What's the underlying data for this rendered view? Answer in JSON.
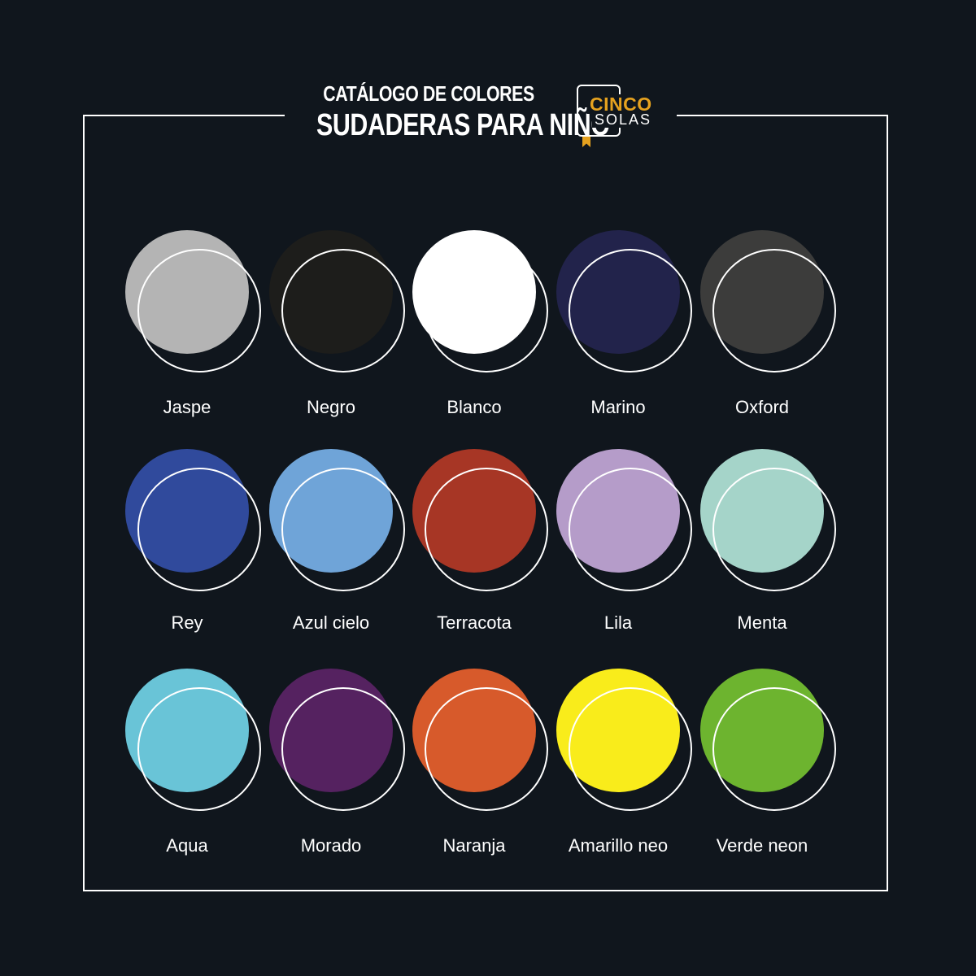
{
  "header": {
    "title_small": "CATÁLOGO DE COLORES",
    "title_large": "SUDADERAS PARA NIÑO"
  },
  "logo": {
    "line1": "CINCO",
    "line2": "SOLAS",
    "accent_color": "#e6a21f"
  },
  "colors": {
    "background": "#10161d",
    "outline": "#ffffff"
  },
  "swatches": [
    {
      "name": "Jaspe",
      "color": "#b4b4b4"
    },
    {
      "name": "Negro",
      "color": "#1d1d1b"
    },
    {
      "name": "Blanco",
      "color": "#ffffff"
    },
    {
      "name": "Marino",
      "color": "#22234b"
    },
    {
      "name": "Oxford",
      "color": "#3c3c3b"
    },
    {
      "name": "Rey",
      "color": "#304a9c"
    },
    {
      "name": "Azul cielo",
      "color": "#6fa4d8"
    },
    {
      "name": "Terracota",
      "color": "#a73625"
    },
    {
      "name": "Lila",
      "color": "#b59cc9"
    },
    {
      "name": "Menta",
      "color": "#a5d4c9"
    },
    {
      "name": "Aqua",
      "color": "#69c4d7"
    },
    {
      "name": "Morado",
      "color": "#552260"
    },
    {
      "name": "Naranja",
      "color": "#d75a2b"
    },
    {
      "name": "Amarillo neo",
      "color": "#f9ec1b"
    },
    {
      "name": "Verde neon",
      "color": "#6db42f"
    }
  ]
}
